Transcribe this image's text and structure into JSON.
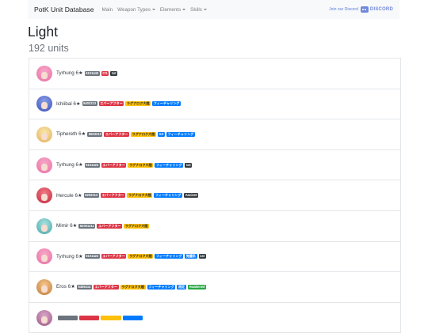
{
  "nav": {
    "brand": "PotK Unit Database",
    "items": [
      {
        "label": "Main",
        "dropdown": false
      },
      {
        "label": "Weapon Types",
        "dropdown": true
      },
      {
        "label": "Elements",
        "dropdown": true
      },
      {
        "label": "Skills",
        "dropdown": true
      }
    ],
    "join_label": "Join our Discord",
    "discord_label": "DISCORD"
  },
  "page": {
    "title": "Light",
    "count": "192 units"
  },
  "colors": {
    "secondary": "#6c757d",
    "danger": "#dc3545",
    "warning": "#ffc107",
    "primary": "#007bff",
    "dark": "#343a40",
    "success": "#28a745",
    "discord": "#7289da"
  },
  "units": [
    {
      "name": "Tyrhung 6★",
      "avatar": [
        "#f7a7c8",
        "#e86fa3"
      ],
      "badges": [
        {
          "text": "6101443",
          "kind": "secondary"
        },
        {
          "text": "CG",
          "kind": "danger"
        },
        {
          "text": "1st",
          "kind": "dark"
        }
      ]
    },
    {
      "name": "Ichiibal 6★",
      "avatar": [
        "#8aa0e6",
        "#3b4fb8"
      ],
      "badges": [
        {
          "text": "6402213",
          "kind": "secondary"
        },
        {
          "text": "エバーアフター",
          "kind": "danger"
        },
        {
          "text": "ラグナロク大陸",
          "kind": "warning"
        },
        {
          "text": "フィーチャリング",
          "kind": "primary"
        }
      ]
    },
    {
      "name": "Tiphereth 6★",
      "avatar": [
        "#fbe6a6",
        "#e0b060"
      ],
      "badges": [
        {
          "text": "6503213",
          "kind": "secondary"
        },
        {
          "text": "エバーアフター",
          "kind": "danger"
        },
        {
          "text": "ラグナロク大陸",
          "kind": "warning"
        },
        {
          "text": "GX",
          "kind": "primary"
        },
        {
          "text": "フィーチャリング",
          "kind": "primary"
        }
      ]
    },
    {
      "name": "Tyrhung 6★",
      "avatar": [
        "#f7a7c8",
        "#e86fa3"
      ],
      "badges": [
        {
          "text": "6101423",
          "kind": "secondary"
        },
        {
          "text": "エバーアフター",
          "kind": "danger"
        },
        {
          "text": "ラグナロク大陸",
          "kind": "warning"
        },
        {
          "text": "フィーチャリング",
          "kind": "primary"
        },
        {
          "text": "1st",
          "kind": "dark"
        }
      ]
    },
    {
      "name": "Hercule 6★",
      "avatar": [
        "#f27a86",
        "#c1283c"
      ],
      "badges": [
        {
          "text": "6202313",
          "kind": "secondary"
        },
        {
          "text": "エバーアフター",
          "kind": "danger"
        },
        {
          "text": "ラグナロク大陸",
          "kind": "warning"
        },
        {
          "text": "フィーチャリング",
          "kind": "primary"
        },
        {
          "text": "Ancient",
          "kind": "dark"
        }
      ]
    },
    {
      "name": "Mimir 6★",
      "avatar": [
        "#a9e0e0",
        "#4aa8a8"
      ],
      "badges": [
        {
          "text": "62001211",
          "kind": "secondary"
        },
        {
          "text": "エバーアフター",
          "kind": "danger"
        },
        {
          "text": "ラグナロク大陸",
          "kind": "warning"
        }
      ]
    },
    {
      "name": "Tyrhung 6★",
      "avatar": [
        "#f7a7c8",
        "#e86fa3"
      ],
      "badges": [
        {
          "text": "6101423",
          "kind": "secondary"
        },
        {
          "text": "エバーアフター",
          "kind": "danger"
        },
        {
          "text": "ラグナロク大陸",
          "kind": "warning"
        },
        {
          "text": "フィーチャリング",
          "kind": "primary"
        },
        {
          "text": "覚醒系",
          "kind": "primary"
        },
        {
          "text": "1st",
          "kind": "dark"
        }
      ]
    },
    {
      "name": "Eros 6★",
      "avatar": [
        "#f5c78a",
        "#c07a3a"
      ],
      "badges": [
        {
          "text": "6405414",
          "kind": "secondary"
        },
        {
          "text": "エバーアフター",
          "kind": "danger"
        },
        {
          "text": "ラグナロク大陸",
          "kind": "warning"
        },
        {
          "text": "フィーチャリング",
          "kind": "primary"
        },
        {
          "text": "限定",
          "kind": "primary"
        },
        {
          "text": "Awakened",
          "kind": "success"
        }
      ]
    },
    {
      "name": "",
      "avatar": [
        "#d9a6c8",
        "#9c5a86"
      ],
      "badges": [
        {
          "text": "",
          "kind": "secondary"
        },
        {
          "text": "",
          "kind": "danger"
        },
        {
          "text": "",
          "kind": "warning"
        },
        {
          "text": "",
          "kind": "primary"
        }
      ]
    }
  ]
}
